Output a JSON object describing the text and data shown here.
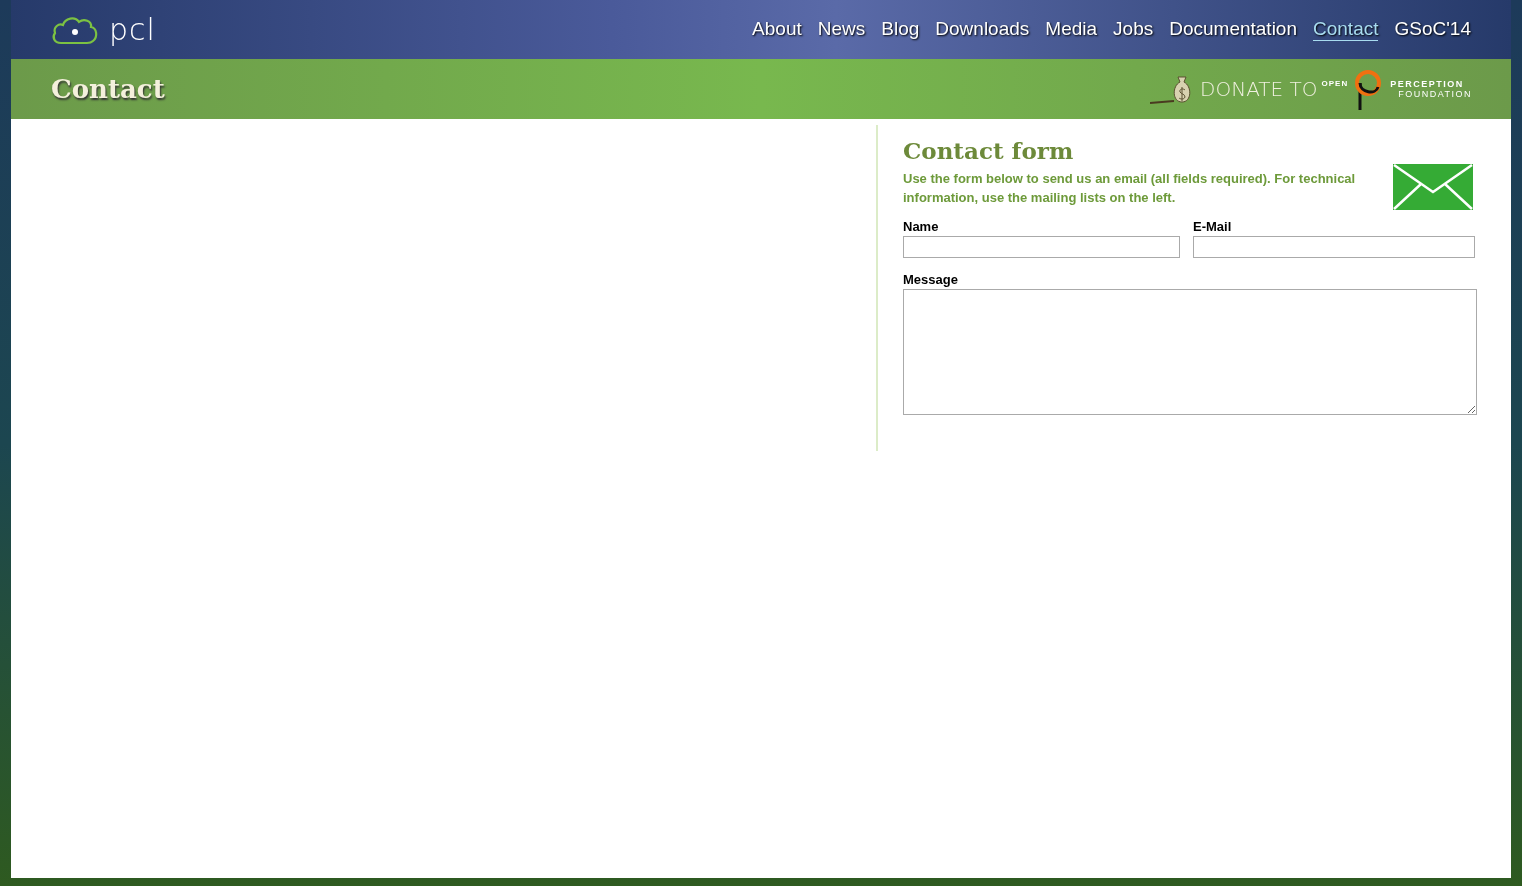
{
  "logo": {
    "text": "pcl"
  },
  "nav": [
    {
      "label": "About",
      "selected": false
    },
    {
      "label": "News",
      "selected": false
    },
    {
      "label": "Blog",
      "selected": false
    },
    {
      "label": "Downloads",
      "selected": false
    },
    {
      "label": "Media",
      "selected": false
    },
    {
      "label": "Jobs",
      "selected": false
    },
    {
      "label": "Documentation",
      "selected": false
    },
    {
      "label": "Contact",
      "selected": true
    },
    {
      "label": "GSoC'14",
      "selected": false
    }
  ],
  "page_title": "Contact",
  "donate": {
    "label": "DONATE TO",
    "org_prefix": "OPEN",
    "org_line1": "PERCEPTION",
    "org_line2": "FOUNDATION"
  },
  "contact_form": {
    "title": "Contact form",
    "intro": "Use the form below to send us an email (all fields required). For technical information, use the mailing lists on the left.",
    "fields": [
      {
        "label": "Name",
        "kind": "text"
      },
      {
        "label": "E-Mail",
        "kind": "text"
      },
      {
        "label": "Message",
        "kind": "textarea"
      }
    ]
  }
}
